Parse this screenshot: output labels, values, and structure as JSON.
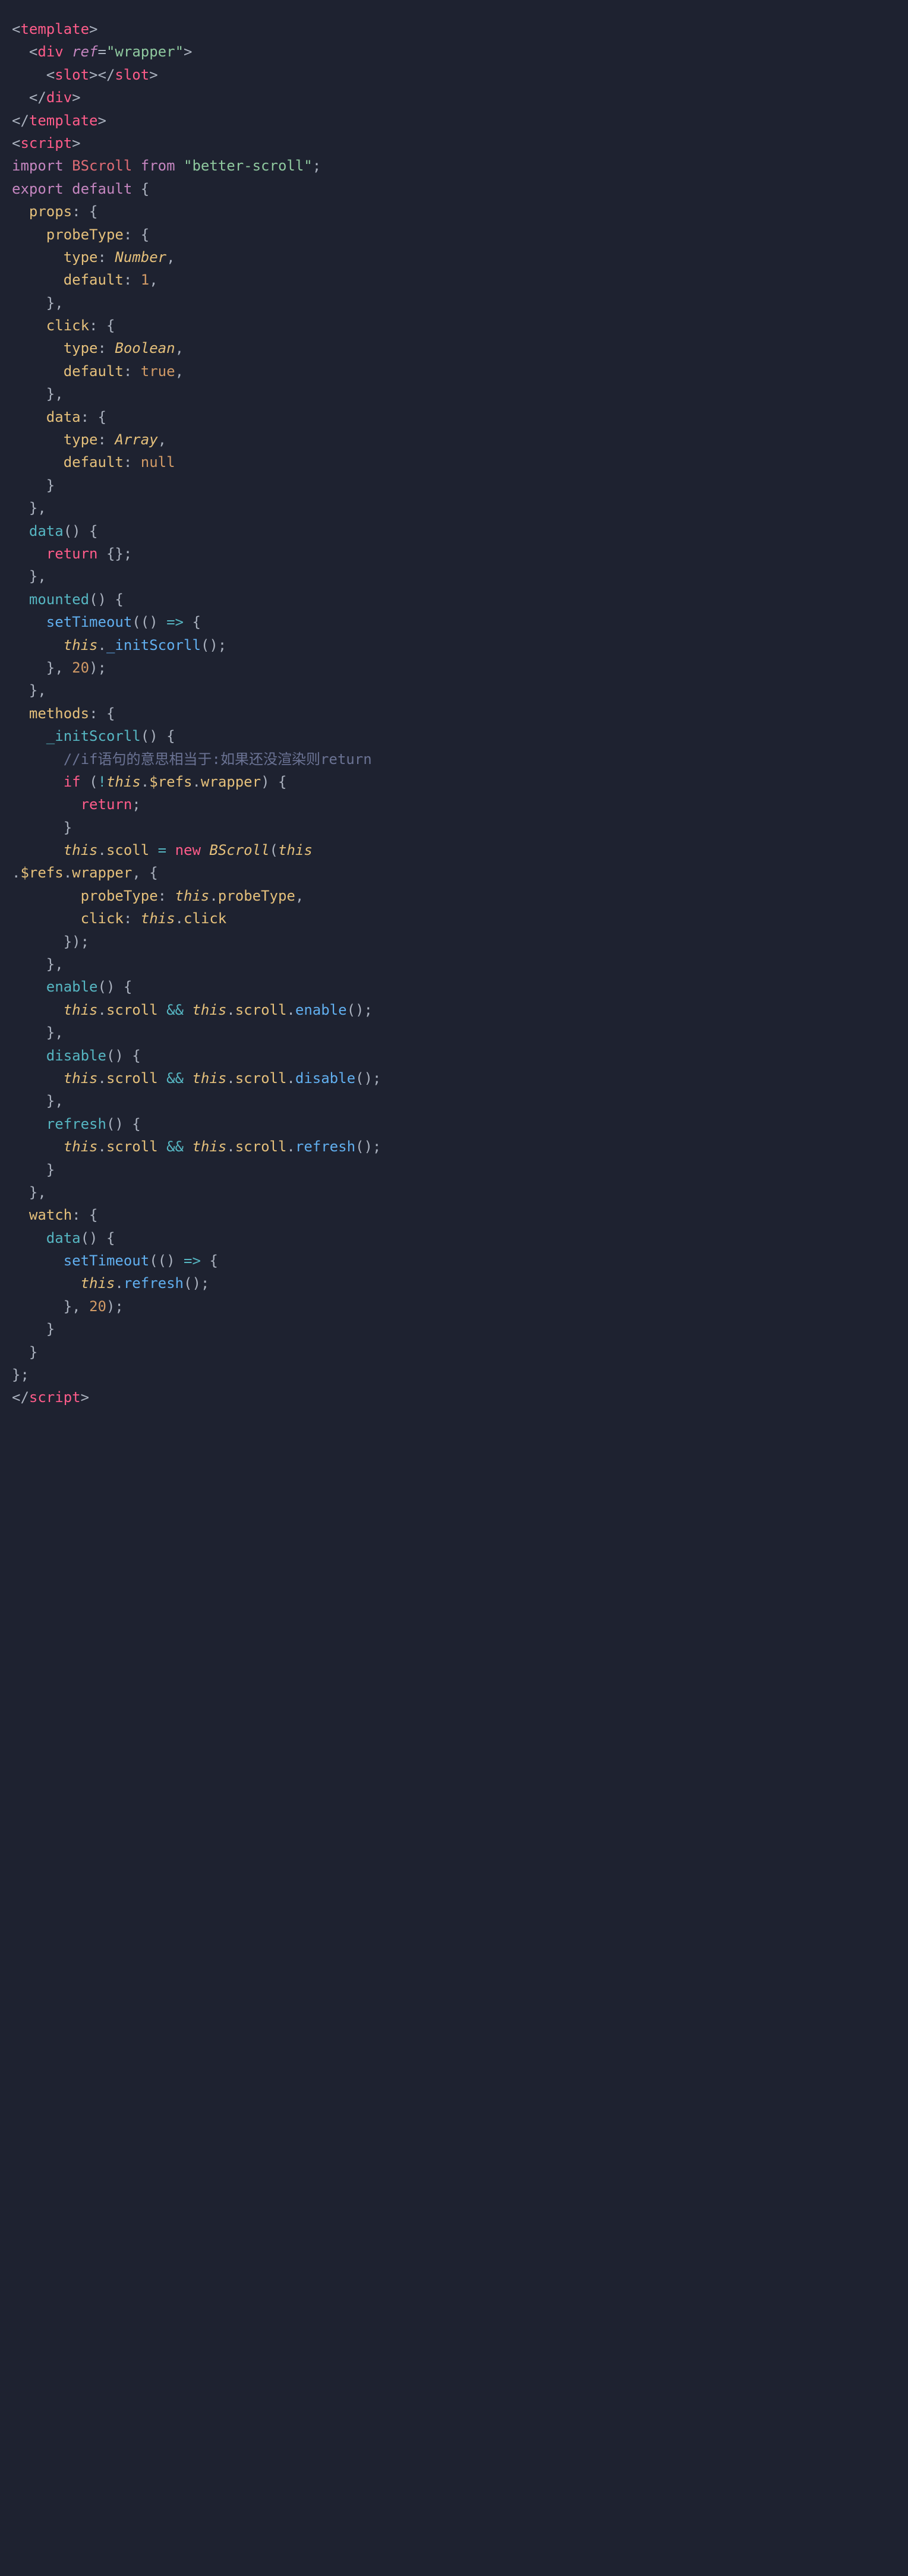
{
  "code": {
    "lines": [
      {
        "t": "tag_open",
        "name": "template"
      },
      {
        "t": "div_open",
        "indent": "  ",
        "attr": "ref",
        "val": "\"wrapper\""
      },
      {
        "t": "tag_pair",
        "indent": "    ",
        "name": "slot"
      },
      {
        "t": "tag_close",
        "indent": "  ",
        "name": "div"
      },
      {
        "t": "tag_close",
        "indent": "",
        "name": "template"
      },
      {
        "t": "tag_open",
        "name": "script"
      },
      {
        "t": "import",
        "ident": "BScroll",
        "from": "\"better-scroll\""
      },
      {
        "t": "export_default"
      },
      {
        "t": "prop_brace",
        "indent": "  ",
        "name": "props"
      },
      {
        "t": "prop_brace",
        "indent": "    ",
        "name": "probeType"
      },
      {
        "t": "kv",
        "indent": "      ",
        "key": "type",
        "val": "Number",
        "vt": "type"
      },
      {
        "t": "kv",
        "indent": "      ",
        "key": "default",
        "val": "1",
        "vt": "num"
      },
      {
        "t": "close_comma",
        "indent": "    "
      },
      {
        "t": "prop_brace",
        "indent": "    ",
        "name": "click"
      },
      {
        "t": "kv",
        "indent": "      ",
        "key": "type",
        "val": "Boolean",
        "vt": "type"
      },
      {
        "t": "kv",
        "indent": "      ",
        "key": "default",
        "val": "true",
        "vt": "bool"
      },
      {
        "t": "close_comma",
        "indent": "    "
      },
      {
        "t": "prop_brace",
        "indent": "    ",
        "name": "data"
      },
      {
        "t": "kv",
        "indent": "      ",
        "key": "type",
        "val": "Array",
        "vt": "type"
      },
      {
        "t": "kv_nc",
        "indent": "      ",
        "key": "default",
        "val": "null",
        "vt": "null"
      },
      {
        "t": "close",
        "indent": "    "
      },
      {
        "t": "close_comma",
        "indent": "  "
      },
      {
        "t": "method",
        "indent": "  ",
        "name": "data"
      },
      {
        "t": "return_obj",
        "indent": "    "
      },
      {
        "t": "close_comma",
        "indent": "  "
      },
      {
        "t": "method",
        "indent": "  ",
        "name": "mounted"
      },
      {
        "t": "settimeout",
        "indent": "    "
      },
      {
        "t": "this_call",
        "indent": "      ",
        "method": "_initScorll"
      },
      {
        "t": "settimeout_close",
        "indent": "    ",
        "ms": "20"
      },
      {
        "t": "close_comma",
        "indent": "  "
      },
      {
        "t": "prop_brace",
        "indent": "  ",
        "name": "methods"
      },
      {
        "t": "method",
        "indent": "    ",
        "name": "_initScorll"
      },
      {
        "t": "comment",
        "indent": "      ",
        "text": "//if语句的意思相当于:如果还没渲染则return"
      },
      {
        "t": "if_not_refs",
        "indent": "      "
      },
      {
        "t": "return_only",
        "indent": "        "
      },
      {
        "t": "close",
        "indent": "      "
      },
      {
        "t": "scoll_new",
        "indent": "      "
      },
      {
        "t": "refs_wrapper"
      },
      {
        "t": "kv_this",
        "indent": "        ",
        "key": "probeType",
        "prop": "probeType"
      },
      {
        "t": "kv_this_nc",
        "indent": "        ",
        "key": "click",
        "prop": "click"
      },
      {
        "t": "close_paren_semi",
        "indent": "      "
      },
      {
        "t": "close_comma",
        "indent": "    "
      },
      {
        "t": "method",
        "indent": "    ",
        "name": "enable"
      },
      {
        "t": "scroll_guard",
        "indent": "      ",
        "method": "enable"
      },
      {
        "t": "close_comma",
        "indent": "    "
      },
      {
        "t": "method",
        "indent": "    ",
        "name": "disable"
      },
      {
        "t": "scroll_guard",
        "indent": "      ",
        "method": "disable"
      },
      {
        "t": "close_comma",
        "indent": "    "
      },
      {
        "t": "method",
        "indent": "    ",
        "name": "refresh"
      },
      {
        "t": "scroll_guard",
        "indent": "      ",
        "method": "refresh"
      },
      {
        "t": "close",
        "indent": "    "
      },
      {
        "t": "close_comma",
        "indent": "  "
      },
      {
        "t": "prop_brace",
        "indent": "  ",
        "name": "watch"
      },
      {
        "t": "method",
        "indent": "    ",
        "name": "data"
      },
      {
        "t": "settimeout",
        "indent": "      "
      },
      {
        "t": "this_call",
        "indent": "        ",
        "method": "refresh"
      },
      {
        "t": "settimeout_close",
        "indent": "      ",
        "ms": "20"
      },
      {
        "t": "close",
        "indent": "    "
      },
      {
        "t": "close",
        "indent": "  "
      },
      {
        "t": "close_semi",
        "indent": ""
      },
      {
        "t": "tag_close",
        "indent": "",
        "name": "script"
      }
    ]
  }
}
